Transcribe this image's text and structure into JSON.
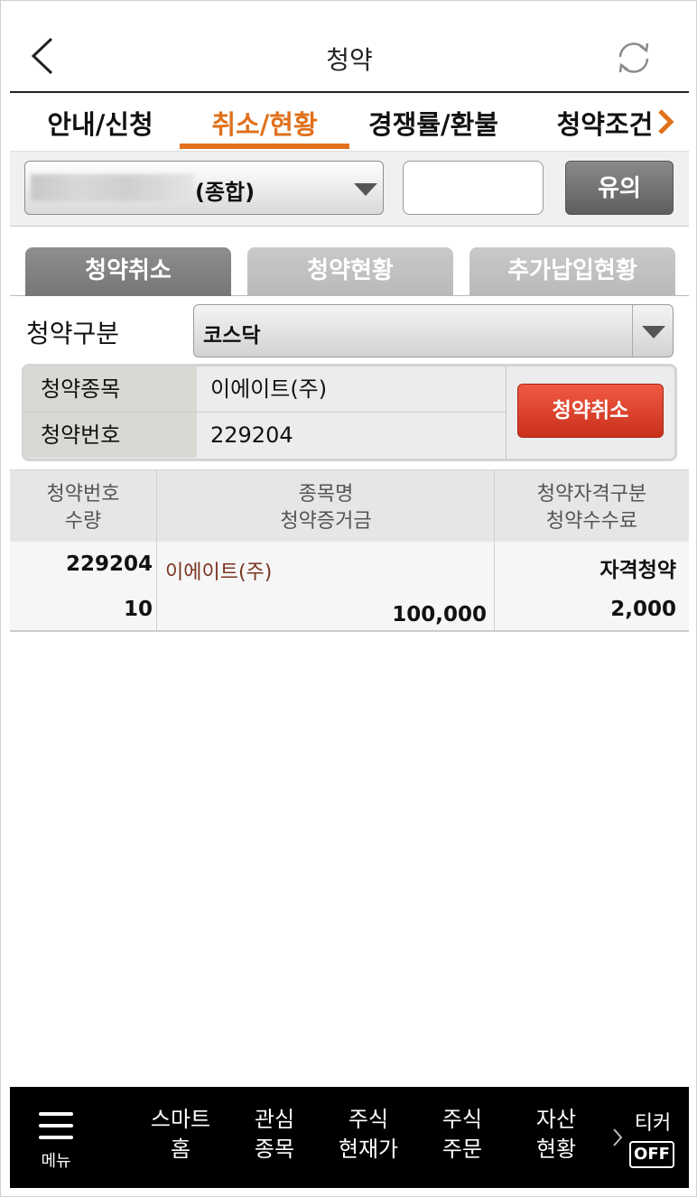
{
  "header": {
    "title": "청약",
    "back_icon": "back-chevron-icon",
    "refresh_icon": "refresh-icon"
  },
  "top_tabs": [
    {
      "label": "안내/신청",
      "active": false
    },
    {
      "label": "취소/현황",
      "active": true
    },
    {
      "label": "경쟁률/환불",
      "active": false
    },
    {
      "label": "청약조건",
      "active": false
    }
  ],
  "account": {
    "account_type": "(종합)",
    "password_placeholder": "",
    "notice_button": "유의"
  },
  "sub_tabs": [
    {
      "label": "청약취소",
      "active": true
    },
    {
      "label": "청약현황",
      "active": false
    },
    {
      "label": "추가납입현황",
      "active": false
    }
  ],
  "filter": {
    "label": "청약구분",
    "value": "코스닥"
  },
  "info": {
    "stock_label": "청약종목",
    "stock_value": "이에이트(주)",
    "number_label": "청약번호",
    "number_value": "229204",
    "cancel_button": "청약취소"
  },
  "table": {
    "headers": [
      {
        "line1": "청약번호",
        "line2": "수량"
      },
      {
        "line1": "종목명",
        "line2": "청약증거금"
      },
      {
        "line1": "청약자격구분",
        "line2": "청약수수료"
      }
    ],
    "rows": [
      {
        "number": "229204",
        "quantity": "10",
        "name": "이에이트(주)",
        "deposit": "100,000",
        "qualification": "자격청약",
        "fee": "2,000"
      }
    ]
  },
  "bottom_nav": {
    "menu_label": "메뉴",
    "items": [
      {
        "line1": "스마트",
        "line2": "홈"
      },
      {
        "line1": "관심",
        "line2": "종목"
      },
      {
        "line1": "주식",
        "line2": "현재가"
      },
      {
        "line1": "주식",
        "line2": "주문"
      },
      {
        "line1": "자산",
        "line2": "현황"
      }
    ],
    "ticker_label": "티커",
    "ticker_state": "OFF"
  },
  "colors": {
    "accent": "#e0701c",
    "cancel_red": "#d9381f",
    "stock_name": "#7a3420",
    "nav_bg": "#000000"
  }
}
